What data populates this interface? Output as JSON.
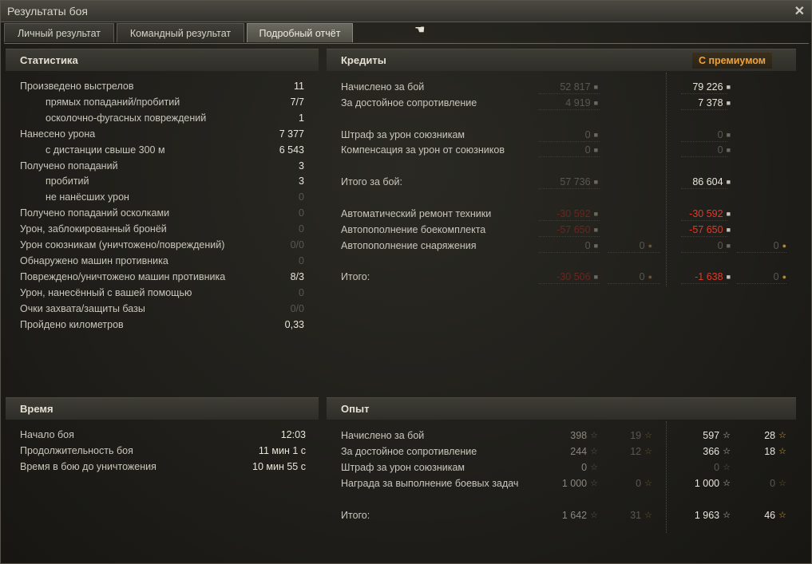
{
  "window": {
    "title": "Результаты боя"
  },
  "tabs": [
    {
      "label": "Личный результат",
      "active": false
    },
    {
      "label": "Командный результат",
      "active": false
    },
    {
      "label": "Подробный отчёт",
      "active": true
    }
  ],
  "statistics": {
    "header": "Статистика",
    "rows": [
      {
        "label": "Произведено выстрелов",
        "value": "11",
        "indent": false,
        "dim": false
      },
      {
        "label": "прямых попаданий/пробитий",
        "value": "7/7",
        "indent": true,
        "dim": false
      },
      {
        "label": "осколочно-фугасных повреждений",
        "value": "1",
        "indent": true,
        "dim": false
      },
      {
        "label": "Нанесено урона",
        "value": "7 377",
        "indent": false,
        "dim": false
      },
      {
        "label": "с дистанции свыше 300 м",
        "value": "6 543",
        "indent": true,
        "dim": false
      },
      {
        "label": "Получено попаданий",
        "value": "3",
        "indent": false,
        "dim": false
      },
      {
        "label": "пробитий",
        "value": "3",
        "indent": true,
        "dim": false
      },
      {
        "label": "не нанёсших урон",
        "value": "0",
        "indent": true,
        "dim": true
      },
      {
        "label": "Получено попаданий осколками",
        "value": "0",
        "indent": false,
        "dim": true
      },
      {
        "label": "Урон, заблокированный бронёй",
        "value": "0",
        "indent": false,
        "dim": true
      },
      {
        "label": "Урон союзникам (уничтожено/повреждений)",
        "value": "0/0",
        "indent": false,
        "dim": true
      },
      {
        "label": "Обнаружено машин противника",
        "value": "0",
        "indent": false,
        "dim": true
      },
      {
        "label": "Повреждено/уничтожено машин противника",
        "value": "8/3",
        "indent": false,
        "dim": false
      },
      {
        "label": "Урон, нанесённый с вашей помощью",
        "value": "0",
        "indent": false,
        "dim": true
      },
      {
        "label": "Очки захвата/защиты базы",
        "value": "0/0",
        "indent": false,
        "dim": true
      },
      {
        "label": "Пройдено километров",
        "value": "0,33",
        "indent": false,
        "dim": false
      }
    ]
  },
  "time": {
    "header": "Время",
    "rows": [
      {
        "label": "Начало боя",
        "value": "12:03"
      },
      {
        "label": "Продолжительность боя",
        "value": "11 мин 1 с"
      },
      {
        "label": "Время в бою до уничтожения",
        "value": "10 мин 55 с"
      }
    ]
  },
  "credits": {
    "header": "Кредиты",
    "premium_label": "С премиумом",
    "rows": [
      {
        "label": "Начислено за бой",
        "c": "52 817",
        "g": "",
        "pc": "79 226",
        "pg": "",
        "cstyle": "dim",
        "pstyle": "bright"
      },
      {
        "label": "За достойное сопротивление",
        "c": "4 919",
        "g": "",
        "pc": "7 378",
        "pg": "",
        "cstyle": "dim",
        "pstyle": "bright"
      },
      {
        "label": "",
        "c": "",
        "g": "",
        "pc": "",
        "pg": "",
        "cstyle": "dim",
        "pstyle": "dim"
      },
      {
        "label": "Штраф за урон союзникам",
        "c": "0",
        "g": "",
        "pc": "0",
        "pg": "",
        "cstyle": "dim",
        "pstyle": "dim"
      },
      {
        "label": "Компенсация за урон от союзников",
        "c": "0",
        "g": "",
        "pc": "0",
        "pg": "",
        "cstyle": "dim",
        "pstyle": "dim"
      },
      {
        "label": "",
        "c": "",
        "g": "",
        "pc": "",
        "pg": "",
        "cstyle": "dim",
        "pstyle": "dim"
      },
      {
        "label": "Итого за бой:",
        "c": "57 736",
        "g": "",
        "pc": "86 604",
        "pg": "",
        "cstyle": "dim",
        "pstyle": "bright"
      },
      {
        "label": "",
        "c": "",
        "g": "",
        "pc": "",
        "pg": "",
        "cstyle": "dim",
        "pstyle": "dim"
      },
      {
        "label": "Автоматический ремонт техники",
        "c": "-30 592",
        "g": "",
        "pc": "-30 592",
        "pg": "",
        "cstyle": "reddim",
        "pstyle": "red"
      },
      {
        "label": "Автопополнение боекомплекта",
        "c": "-57 650",
        "g": "",
        "pc": "-57 650",
        "pg": "",
        "cstyle": "reddim",
        "pstyle": "red"
      },
      {
        "label": "Автопополнение снаряжения",
        "c": "0",
        "g": "0",
        "pc": "0",
        "pg": "0",
        "cstyle": "dim",
        "pstyle": "dim"
      },
      {
        "label": "",
        "c": "",
        "g": "",
        "pc": "",
        "pg": "",
        "cstyle": "dim",
        "pstyle": "dim"
      },
      {
        "label": "Итого:",
        "c": "-30 506",
        "g": "0",
        "pc": "-1 638",
        "pg": "0",
        "cstyle": "reddim",
        "pstyle": "red"
      }
    ]
  },
  "experience": {
    "header": "Опыт",
    "rows": [
      {
        "label": "Начислено за бой",
        "xp": "398",
        "fxp": "19",
        "pxp": "597",
        "pfxp": "28",
        "blank": false
      },
      {
        "label": "За достойное сопротивление",
        "xp": "244",
        "fxp": "12",
        "pxp": "366",
        "pfxp": "18",
        "blank": false
      },
      {
        "label": "Штраф за урон союзникам",
        "xp": "0",
        "fxp": "",
        "pxp": "0",
        "pfxp": "",
        "blank": false
      },
      {
        "label": "Награда за выполнение боевых задач",
        "xp": "1 000",
        "fxp": "0",
        "pxp": "1 000",
        "pfxp": "0",
        "blank": false
      },
      {
        "label": "",
        "xp": "",
        "fxp": "",
        "pxp": "",
        "pfxp": "",
        "blank": true
      },
      {
        "label": "Итого:",
        "xp": "1 642",
        "fxp": "31",
        "pxp": "1 963",
        "pfxp": "46",
        "blank": false
      }
    ]
  },
  "icons": {
    "credit": "credit-coin-icon",
    "gold": "gold-coin-icon",
    "xp": "star-icon",
    "free_xp": "gold-star-icon",
    "close": "close-icon",
    "cursor": "hand-cursor-icon"
  },
  "colors": {
    "premium": "#f0a33b",
    "negative": "#e23a2a",
    "gold_star": "#d2a33b"
  }
}
